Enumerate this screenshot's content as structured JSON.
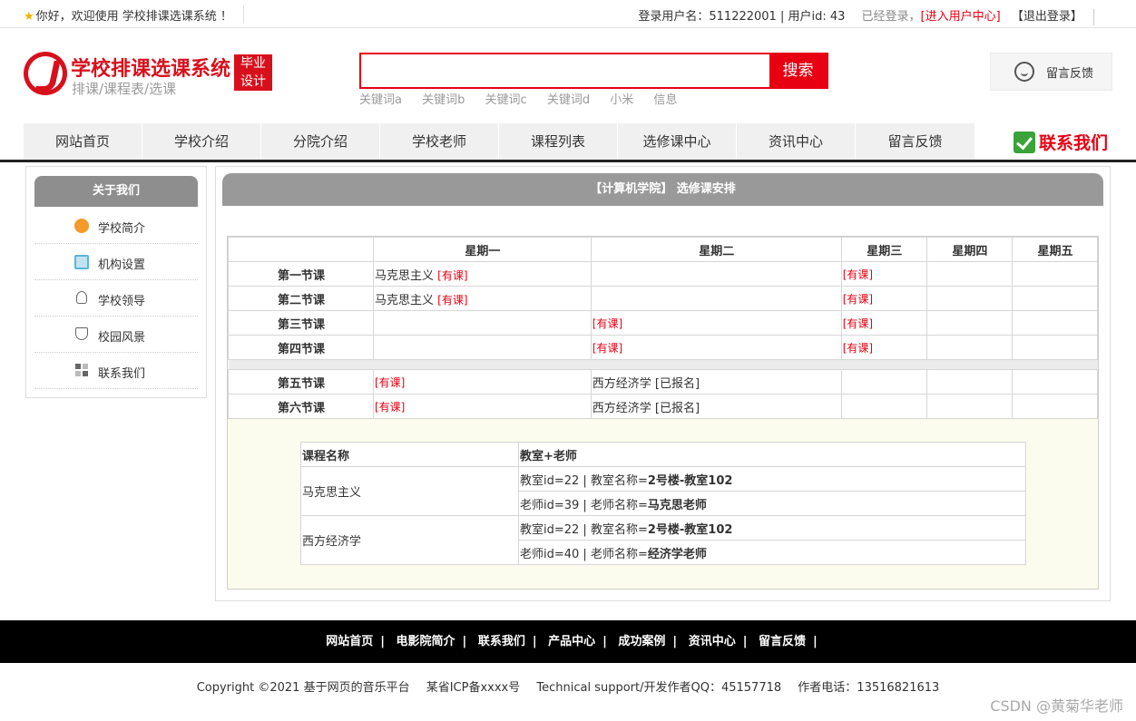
{
  "topbar": {
    "welcome": "你好，欢迎使用 学校排课选课系统 ！",
    "login_info": "登录用户名：511222001 | 用户id: 43",
    "logged_in": "已经登录，",
    "user_center": "[进入用户中心]",
    "logout": "【退出登录】"
  },
  "header": {
    "title": "学校排课选课系统",
    "subtitle": "排课/课程表/选课",
    "tag_line1": "毕业",
    "tag_line2": "设计",
    "search_placeholder": "",
    "search_button": "搜索",
    "keywords": [
      "关键词a",
      "关键词b",
      "关键词c",
      "关键词d",
      "小米",
      "信息"
    ],
    "feedback": "留言反馈"
  },
  "nav": {
    "items": [
      "网站首页",
      "学校介绍",
      "分院介绍",
      "学校老师",
      "课程列表",
      "选修课中心",
      "资讯中心",
      "留言反馈"
    ],
    "contact": "联系我们"
  },
  "sidebar": {
    "title": "关于我们",
    "items": [
      {
        "label": "学校简介",
        "icon": "orange-circle-icon"
      },
      {
        "label": "机构设置",
        "icon": "clipboard-icon"
      },
      {
        "label": "学校领导",
        "icon": "person-icon"
      },
      {
        "label": "校园风景",
        "icon": "shield-icon"
      },
      {
        "label": "联系我们",
        "icon": "grid-icon"
      }
    ]
  },
  "main": {
    "title": "【计算机学院】 选修课安排",
    "schedule": {
      "days": [
        "星期一",
        "星期二",
        "星期三",
        "星期四",
        "星期五"
      ],
      "rows": [
        {
          "period": "第一节课",
          "cells": [
            [
              "马克思主义 ",
              "[有课]"
            ],
            [
              "",
              ""
            ],
            [
              "",
              "[有课]"
            ],
            [
              "",
              ""
            ],
            [
              "",
              ""
            ]
          ]
        },
        {
          "period": "第二节课",
          "cells": [
            [
              "马克思主义 ",
              "[有课]"
            ],
            [
              "",
              ""
            ],
            [
              "",
              "[有课]"
            ],
            [
              "",
              ""
            ],
            [
              "",
              ""
            ]
          ]
        },
        {
          "period": "第三节课",
          "cells": [
            [
              "",
              ""
            ],
            [
              "",
              "[有课]"
            ],
            [
              "",
              "[有课]"
            ],
            [
              "",
              ""
            ],
            [
              "",
              ""
            ]
          ]
        },
        {
          "period": "第四节课",
          "cells": [
            [
              "",
              ""
            ],
            [
              "",
              "[有课]"
            ],
            [
              "",
              "[有课]"
            ],
            [
              "",
              ""
            ],
            [
              "",
              ""
            ]
          ]
        },
        {
          "period": "第五节课",
          "cells": [
            [
              "",
              "[有课]"
            ],
            [
              "西方经济学 [已报名]",
              ""
            ],
            [
              "",
              ""
            ],
            [
              "",
              ""
            ],
            [
              "",
              ""
            ]
          ]
        },
        {
          "period": "第六节课",
          "cells": [
            [
              "",
              "[有课]"
            ],
            [
              "西方经济学 [已报名]",
              ""
            ],
            [
              "",
              ""
            ],
            [
              "",
              ""
            ],
            [
              "",
              ""
            ]
          ]
        }
      ]
    },
    "courses": {
      "header_name": "课程名称",
      "header_room": "教室+老师",
      "items": [
        {
          "name": "马克思主义",
          "room_prefix": "教室id=22 | 教室名称=",
          "room_name": "2号楼-教室102",
          "teacher_prefix": "老师id=39 | 老师名称=",
          "teacher_name": "马克思老师"
        },
        {
          "name": "西方经济学",
          "room_prefix": "教室id=22 | 教室名称=",
          "room_name": "2号楼-教室102",
          "teacher_prefix": "老师id=40 | 老师名称=",
          "teacher_name": "经济学老师"
        }
      ]
    }
  },
  "footer": {
    "links": [
      "网站首页",
      "电影院简介",
      "联系我们",
      "产品中心",
      "成功案例",
      "资讯中心",
      "留言反馈"
    ],
    "copyright": "Copyright ©2021 基于网页的音乐平台",
    "icp": "某省ICP备xxxx号",
    "support": "Technical support/开发作者QQ：45157718",
    "phone": "作者电话：13516821613"
  },
  "watermark": "CSDN @黄菊华老师",
  "colors": {
    "brand_red": "#e60012",
    "nav_bg": "#f0f0f0",
    "header_gray": "#999999"
  }
}
